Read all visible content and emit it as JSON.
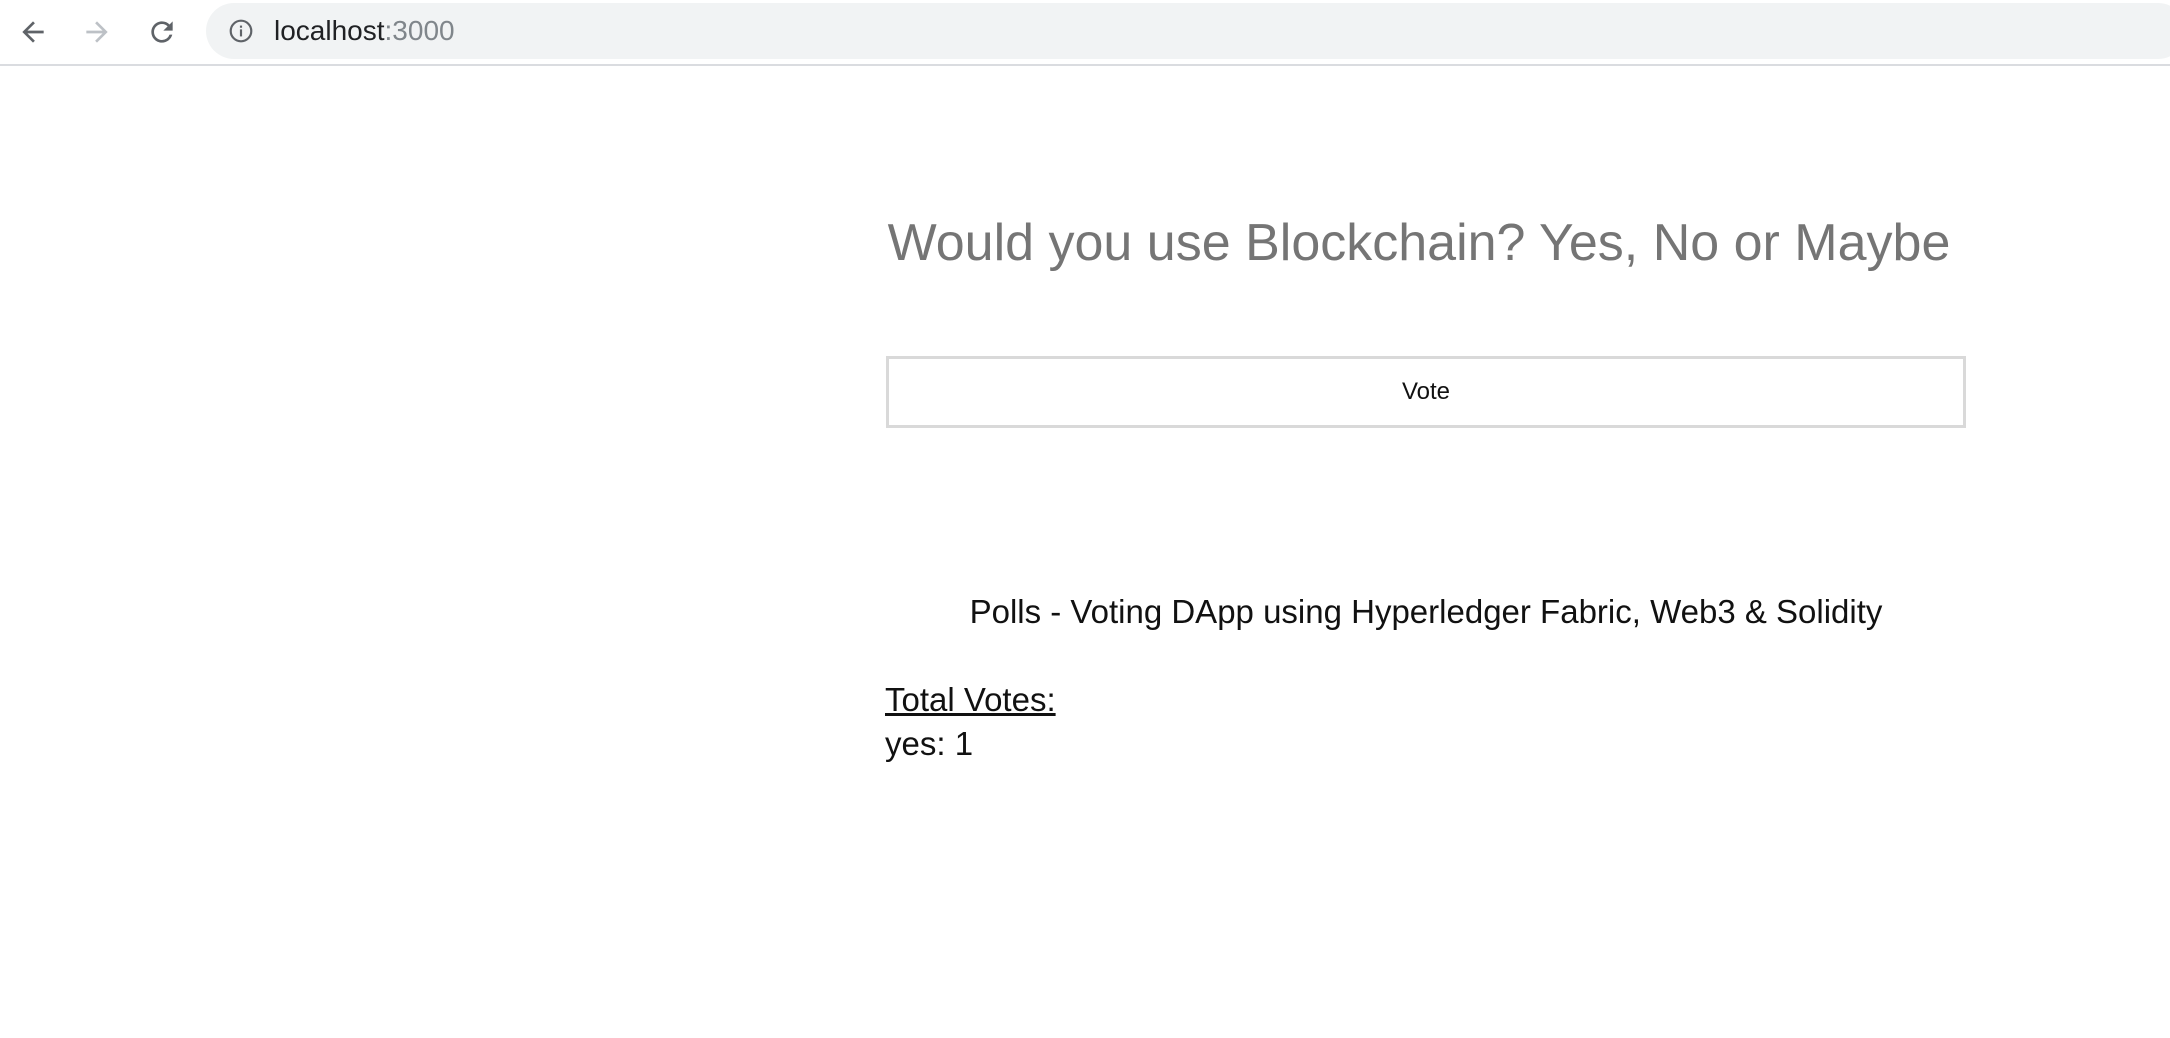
{
  "browser": {
    "url_host": "localhost",
    "url_port": ":3000"
  },
  "icons": {
    "back": "arrow-left-icon",
    "forward": "arrow-right-icon",
    "reload": "reload-icon",
    "site_info": "info-icon"
  },
  "poll": {
    "question": "Would you use Blockchain? Yes, No or Maybe",
    "vote_button_label": "Vote",
    "subtitle": "Polls - Voting DApp using Hyperledger Fabric, Web3 & Solidity",
    "total_votes_label": "Total Votes:",
    "results": [
      {
        "label": "yes",
        "count": "1"
      }
    ]
  },
  "colors": {
    "title_gray": "#757575",
    "text": "#111111",
    "button_border": "#d9d9d9",
    "omnibox_bg": "#f1f3f4"
  }
}
